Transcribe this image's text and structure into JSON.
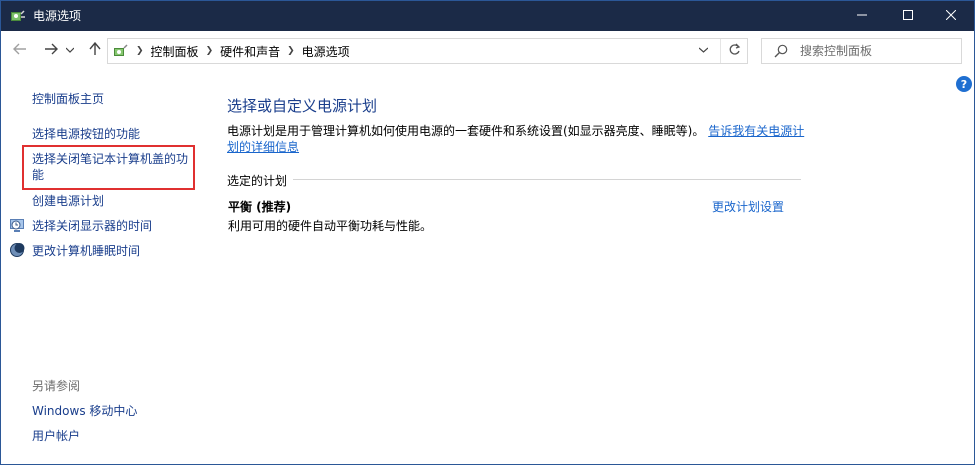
{
  "window": {
    "title": "电源选项",
    "icon": "power-options-icon",
    "buttons": {
      "minimize": "minimize-icon",
      "maximize": "maximize-icon",
      "close": "close-icon"
    }
  },
  "nav": {
    "back_icon": "arrow-left-icon",
    "forward_icon": "arrow-right-icon",
    "recent_icon": "chevron-down-icon",
    "up_icon": "arrow-up-icon",
    "refresh_icon": "refresh-icon"
  },
  "address": {
    "crumbs": [
      "控制面板",
      "硬件和声音",
      "电源选项"
    ]
  },
  "search": {
    "placeholder": "搜索控制面板"
  },
  "sidebar": {
    "home": "控制面板主页",
    "links": [
      "选择电源按钮的功能",
      "选择关闭笔记本计算机盖的功能",
      "创建电源计划",
      "选择关闭显示器的时间",
      "更改计算机睡眠时间"
    ],
    "see_also_header": "另请参阅",
    "see_also": [
      "Windows 移动中心",
      "用户帐户"
    ]
  },
  "main": {
    "title": "选择或自定义电源计划",
    "description": "电源计划是用于管理计算机如何使用电源的一套硬件和系统设置(如显示器亮度、睡眠等)。",
    "description_link": "告诉我有关电源计划的详细信息",
    "selected_plans_label": "选定的计划",
    "plan": {
      "name": "平衡 (推荐)",
      "description": "利用可用的硬件自动平衡功耗与性能。",
      "change_link": "更改计划设置"
    }
  },
  "help": {
    "label": "?"
  },
  "colors": {
    "titlebar": "#1b2a47",
    "link": "#1a3e8c",
    "highlight": "#e03030"
  }
}
